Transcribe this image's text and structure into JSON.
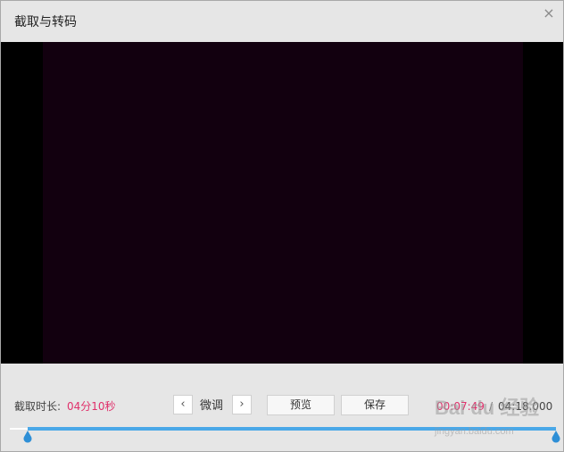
{
  "window": {
    "title": "截取与转码",
    "close_glyph": "×"
  },
  "controls": {
    "duration_label": "截取时长:",
    "duration_value": "04分10秒",
    "prev_glyph": "‹",
    "next_glyph": "›",
    "nudge_label": "微调",
    "preview_label": "预览",
    "save_label": "保存",
    "time_current": "00:07:49",
    "time_separator": "/",
    "time_total": "04:18.000"
  },
  "icons": {
    "close": "close-icon",
    "prev": "chevron-left-icon",
    "next": "chevron-right-icon",
    "handle": "drop-handle-icon"
  },
  "colors": {
    "accent_pink": "#e0306b",
    "track_blue": "#4aa8e8",
    "video_bg": "#12000f"
  },
  "watermark": {
    "brand": "Bai du 经验",
    "url": "jingyan.baidu.com"
  }
}
